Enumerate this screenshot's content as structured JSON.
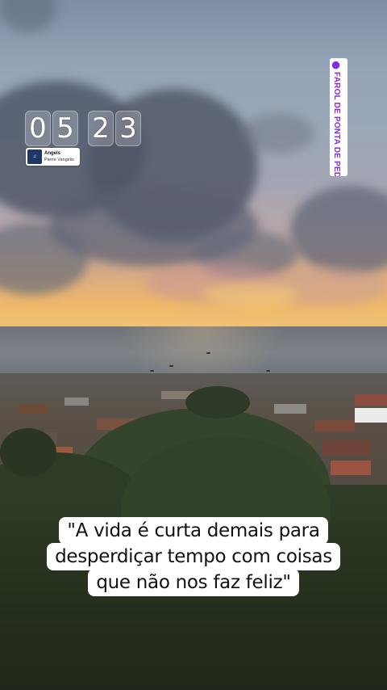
{
  "story": {
    "timer": {
      "digits": [
        "0",
        "5",
        "2",
        "3"
      ]
    },
    "music_sticker": {
      "song": "Angels",
      "artist": "Pierre Vangelis",
      "cover_icon": "album-cover-icon"
    },
    "location_sticker": {
      "text": "FAROL DE PONTA DE PEDRAS.",
      "icon": "location-pin-icon",
      "color": "#8a2be2"
    },
    "quote": {
      "lines": [
        "\"A vida é curta demais para",
        "desperdiçar tempo  com coisas",
        "que não nos faz feliz\""
      ]
    }
  }
}
